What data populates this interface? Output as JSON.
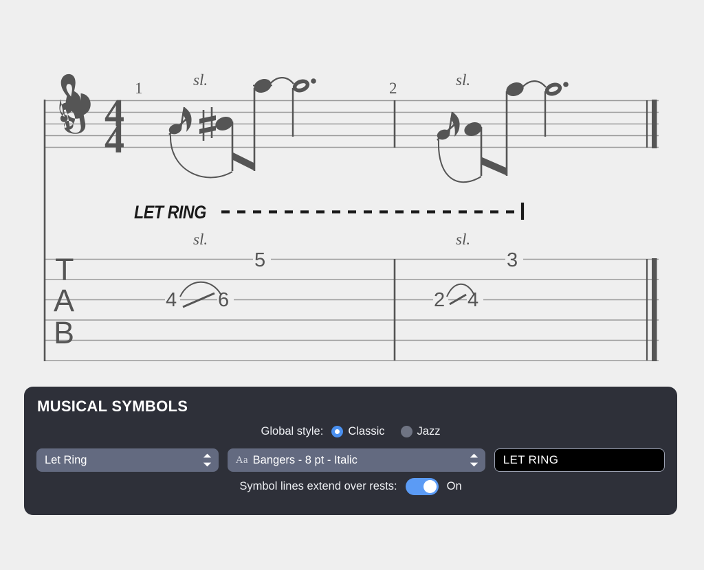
{
  "score": {
    "background": "#efefef",
    "ink": "#555555",
    "staff_line_color": "#9a9a9a",
    "measures": [
      {
        "number": "1",
        "articulation": "sl.",
        "tab_numbers": [
          "4",
          "6",
          "5"
        ],
        "notation": "grace note slide into sharp eighth, tied to dotted half"
      },
      {
        "number": "2",
        "articulation": "sl.",
        "tab_numbers": [
          "2",
          "4",
          "3"
        ],
        "notation": "grace note slide into eighth, tied to dotted half"
      }
    ],
    "clef": "treble-clef",
    "time_signature": {
      "numerator": "4",
      "denominator": "4"
    },
    "tab_label": [
      "T",
      "A",
      "B"
    ],
    "let_ring_text": "LET RING"
  },
  "inspector": {
    "title": "MUSICAL SYMBOLS",
    "global_style": {
      "label": "Global style:",
      "options": [
        {
          "label": "Classic",
          "selected": true
        },
        {
          "label": "Jazz",
          "selected": false
        }
      ]
    },
    "symbol_select": {
      "value": "Let Ring",
      "icon": "stepper-chevrons-icon"
    },
    "font_select": {
      "prefix": "Aa",
      "value": "Bangers - 8 pt - Italic",
      "icon": "stepper-chevrons-icon"
    },
    "symbol_text": {
      "value": "LET RING"
    },
    "extend_over_rests": {
      "label": "Symbol lines extend over rests:",
      "state": "On",
      "on": true
    },
    "colors": {
      "panel_bg": "#2e3039",
      "control_bg": "#636a80",
      "accent": "#4a90f0",
      "toggle_on": "#5b9bf5",
      "radio_off": "#6f7483",
      "textfield_bg": "#000000"
    }
  }
}
